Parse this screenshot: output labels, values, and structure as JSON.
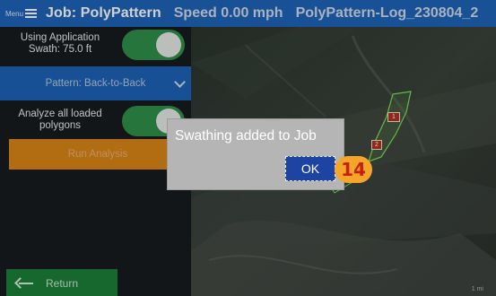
{
  "header": {
    "menu_label": "Menu",
    "job_title": "Job: PolyPattern",
    "speed": "Speed 0.00 mph",
    "log_name": "PolyPattern-Log_230804_2"
  },
  "panel": {
    "swath_label": "Using Application Swath: 75.0 ft",
    "swath_toggle_on": true,
    "pattern_label": "Pattern: Back-to-Back",
    "analyze_label": "Analyze all loaded polygons",
    "analyze_toggle_on": true,
    "run_label": "Run Analysis",
    "return_label": "Return"
  },
  "map": {
    "markers": [
      {
        "label": "1",
        "icon": "field-marker-icon"
      },
      {
        "label": "2",
        "icon": "field-marker-icon"
      }
    ],
    "scale_label": "1 mi"
  },
  "dialog": {
    "message": "Swathing added to Job",
    "ok_label": "OK"
  },
  "tutorial": {
    "step_number": "14"
  },
  "colors": {
    "header_blue": "#1f63b8",
    "toggle_green": "#2f8f4a",
    "run_orange": "#d98616",
    "return_green": "#1d7f3a",
    "ok_blue": "#1e44a3",
    "badge_orange": "#f4a62a",
    "badge_text_red": "#c81e0f",
    "polygon_green": "#7be05a"
  }
}
